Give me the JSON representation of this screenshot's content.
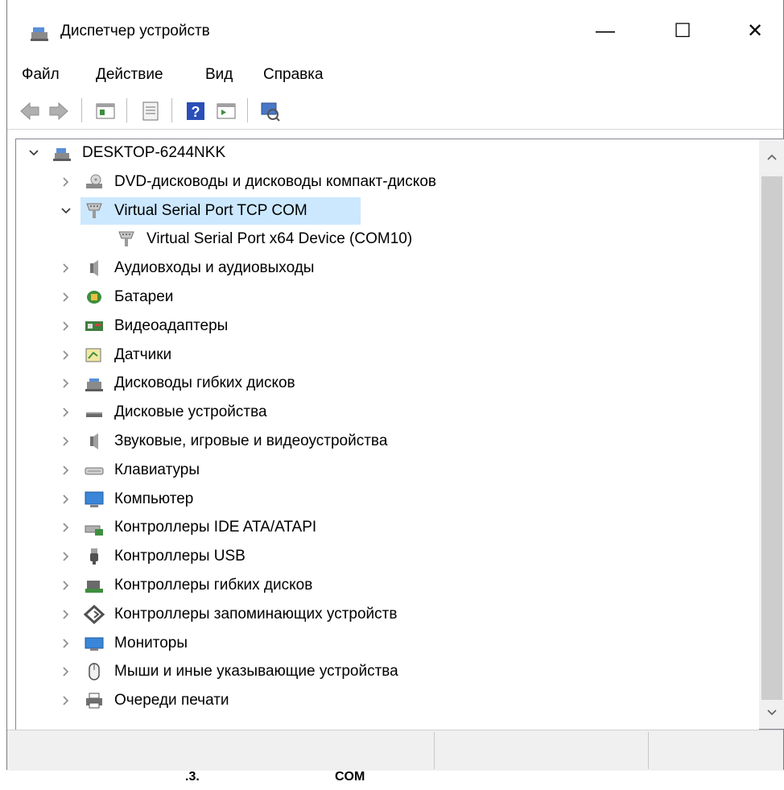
{
  "window": {
    "title": "Диспетчер устройств",
    "minimize": "—",
    "maximize": "☐",
    "close": "✕"
  },
  "menu": {
    "items": [
      "Файл",
      "Действие",
      "Вид",
      "Справка"
    ]
  },
  "toolbar": {
    "buttons": [
      "back-icon",
      "forward-icon",
      "properties-icon",
      "update-driver-icon",
      "help-icon",
      "run-icon",
      "scan-hardware-icon"
    ]
  },
  "tree": {
    "root": "DESKTOP-6244NKK",
    "items": [
      {
        "label": "DVD-дисководы и дисководы компакт-дисков",
        "icon": "dvd-drive-icon",
        "state": "collapsed"
      },
      {
        "label": "Virtual Serial Port TCP COM",
        "icon": "serial-port-icon",
        "state": "expanded",
        "selected": true
      },
      {
        "label": "Virtual Serial Port x64 Device (COM10)",
        "icon": "serial-port-icon",
        "state": "leaf"
      },
      {
        "label": "Аудиовходы и аудиовыходы",
        "icon": "speaker-icon",
        "state": "collapsed"
      },
      {
        "label": "Батареи",
        "icon": "battery-icon",
        "state": "collapsed"
      },
      {
        "label": "Видеоадаптеры",
        "icon": "display-adapter-icon",
        "state": "collapsed"
      },
      {
        "label": "Датчики",
        "icon": "sensor-icon",
        "state": "collapsed"
      },
      {
        "label": "Дисководы гибких дисков",
        "icon": "floppy-drive-icon",
        "state": "collapsed"
      },
      {
        "label": "Дисковые устройства",
        "icon": "disk-drive-icon",
        "state": "collapsed"
      },
      {
        "label": "Звуковые, игровые и видеоустройства",
        "icon": "speaker-icon",
        "state": "collapsed"
      },
      {
        "label": "Клавиатуры",
        "icon": "keyboard-icon",
        "state": "collapsed"
      },
      {
        "label": "Компьютер",
        "icon": "computer-icon",
        "state": "collapsed"
      },
      {
        "label": "Контроллеры IDE ATA/ATAPI",
        "icon": "ide-controller-icon",
        "state": "collapsed"
      },
      {
        "label": "Контроллеры USB",
        "icon": "usb-icon",
        "state": "collapsed"
      },
      {
        "label": "Контроллеры гибких дисков",
        "icon": "floppy-controller-icon",
        "state": "collapsed"
      },
      {
        "label": "Контроллеры запоминающих устройств",
        "icon": "storage-controller-icon",
        "state": "collapsed"
      },
      {
        "label": "Мониторы",
        "icon": "monitor-icon",
        "state": "collapsed"
      },
      {
        "label": "Мыши и иные указывающие устройства",
        "icon": "mouse-icon",
        "state": "collapsed"
      },
      {
        "label": "Очереди печати",
        "icon": "printer-icon",
        "state": "collapsed"
      }
    ]
  },
  "caption": {
    "figure": ".3.",
    "text": "COM"
  },
  "colors": {
    "selection": "#cce8ff",
    "scrollbar_thumb": "#cdcdcd"
  }
}
